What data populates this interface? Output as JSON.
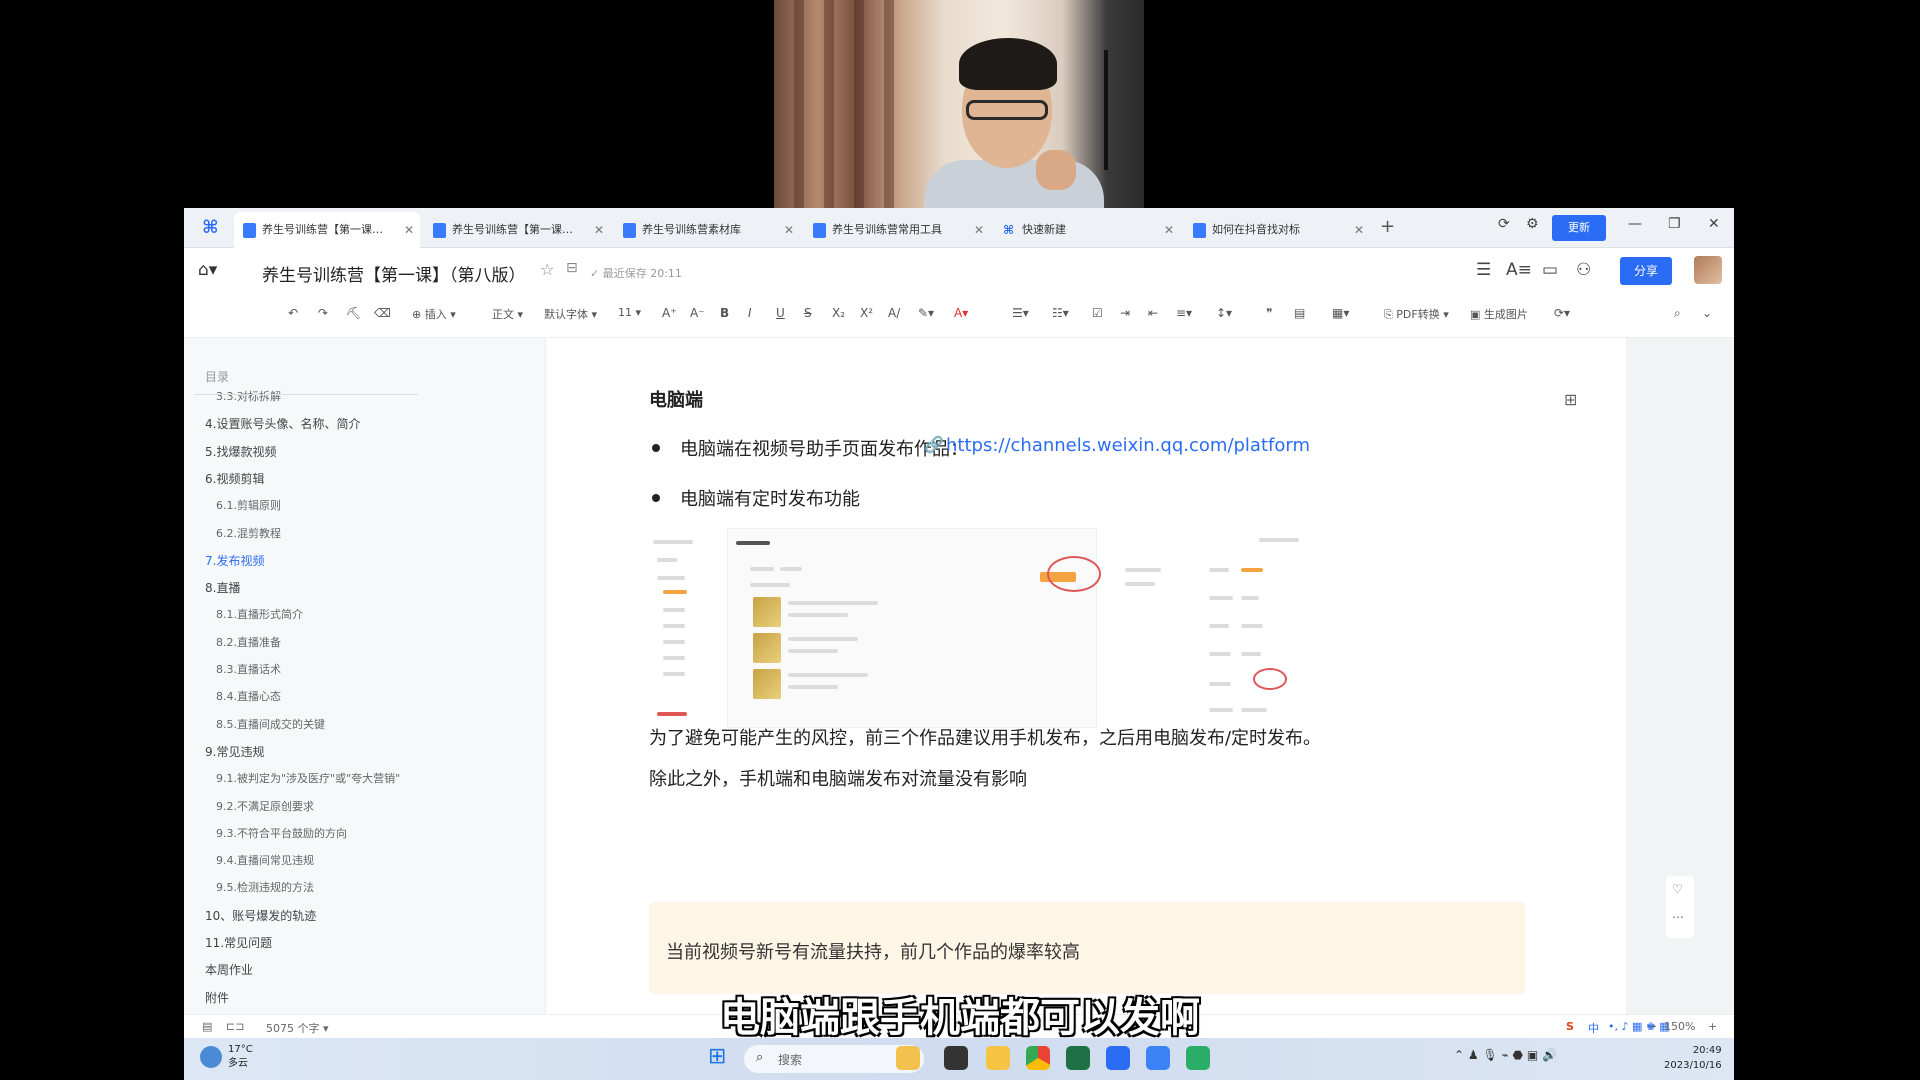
{
  "tabs": [
    {
      "label": "养生号训练营【第一课】..."
    },
    {
      "label": "养生号训练营【第一课】..."
    },
    {
      "label": "养生号训练营素材库"
    },
    {
      "label": "养生号训练营常用工具"
    },
    {
      "label": "快速新建"
    },
    {
      "label": "如何在抖音找对标"
    }
  ],
  "header": {
    "update_label": "更新",
    "doc_title": "养生号训练营【第一课】（第八版）",
    "saved_text": "最近保存 20:11",
    "share_label": "分享"
  },
  "toolbar": {
    "insert": "插入",
    "style": "正文",
    "font": "默认字体",
    "size": "11",
    "pdf": "PDF转换",
    "gen_image": "生成图片"
  },
  "sidebar": {
    "title": "目录",
    "items": [
      {
        "label": "3.3.对标拆解",
        "level": 2
      },
      {
        "label": "4.设置账号头像、名称、简介",
        "level": 1
      },
      {
        "label": "5.找爆款视频",
        "level": 1
      },
      {
        "label": "6.视频剪辑",
        "level": 1
      },
      {
        "label": "6.1.剪辑原则",
        "level": 2
      },
      {
        "label": "6.2.混剪教程",
        "level": 2
      },
      {
        "label": "7.发布视频",
        "level": 1,
        "active": true
      },
      {
        "label": "8.直播",
        "level": 1
      },
      {
        "label": "8.1.直播形式简介",
        "level": 2
      },
      {
        "label": "8.2.直播准备",
        "level": 2
      },
      {
        "label": "8.3.直播话术",
        "level": 2
      },
      {
        "label": "8.4.直播心态",
        "level": 2
      },
      {
        "label": "8.5.直播间成交的关键",
        "level": 2
      },
      {
        "label": "9.常见违规",
        "level": 1
      },
      {
        "label": "9.1.被判定为\"涉及医疗\"或\"夸大营销\"",
        "level": 2
      },
      {
        "label": "9.2.不满足原创要求",
        "level": 2
      },
      {
        "label": "9.3.不符合平台鼓励的方向",
        "level": 2
      },
      {
        "label": "9.4.直播间常见违规",
        "level": 2
      },
      {
        "label": "9.5.检测违规的方法",
        "level": 2
      },
      {
        "label": "10、账号爆发的轨迹",
        "level": 1
      },
      {
        "label": "11.常见问题",
        "level": 1
      },
      {
        "label": "本周作业",
        "level": 1
      },
      {
        "label": "附件",
        "level": 1
      }
    ]
  },
  "document": {
    "heading": "电脑端",
    "bullet1": "电脑端在视频号助手页面发布作品：",
    "link": "https://channels.weixin.qq.com/platform",
    "bullet2": "电脑端有定时发布功能",
    "para1": "为了避免可能产生的风控，前三个作品建议用手机发布，之后用电脑发布/定时发布。",
    "para2": "除此之外，手机端和电脑端发布对流量没有影响",
    "callout": "当前视频号新号有流量扶持，前几个作品的爆率较高"
  },
  "statusbar": {
    "word_count": "5075 个字",
    "zoom": "150%"
  },
  "taskbar": {
    "weather_temp": "17°C",
    "weather_desc": "多云",
    "search_placeholder": "搜索",
    "time": "20:49",
    "date": "2023/10/16",
    "ime_lang": "中"
  },
  "subtitle": "电脑端跟手机端都可以发啊",
  "colors": {
    "accent": "#2b6cf5",
    "callout_bg": "#fdf6e7",
    "active_toc": "#2b6cf5"
  }
}
